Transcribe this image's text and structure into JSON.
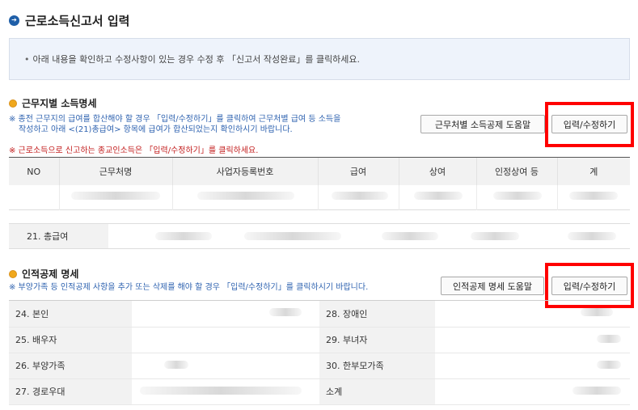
{
  "page": {
    "title": "근로소득신고서 입력"
  },
  "notice": {
    "bullet": "•",
    "text": "아래 내용을 확인하고 수정사항이 있는 경우 수정 후 「신고서 작성완료」를 클릭하세요."
  },
  "section1": {
    "title": "근무지별 소득명세",
    "note_line1": "※ 종전 근무지의 급여를 합산해야 할 경우 「입력/수정하기」를 클릭하여 근무처별 급여 등 소득을",
    "note_line2": "작성하고 아래 <(21)총급여> 항목에 급여가 합산되었는지 확인하시기 바랍니다.",
    "red_note": "※ 근로소득으로 신고하는 종교인소득은 「입력/수정하기」를 클릭하세요.",
    "help_button": "근무처별 소득공제 도움말",
    "edit_button": "입력/수정하기",
    "columns": [
      "NO",
      "근무처명",
      "사업자등록번호",
      "급여",
      "상여",
      "인정상여 등",
      "계"
    ],
    "total_label": "21. 총급여"
  },
  "section2": {
    "title": "인적공제 명세",
    "note": "※ 부양가족 등 인적공제 사항을 추가 또는 삭제를 해야 할 경우 「입력/수정하기」를 클릭하시기 바랍니다.",
    "help_button": "인적공제 명세 도움말",
    "edit_button": "입력/수정하기",
    "rows": [
      {
        "left": "24. 본인",
        "right": "28. 장애인"
      },
      {
        "left": "25. 배우자",
        "right": "29. 부녀자"
      },
      {
        "left": "26. 부양가족",
        "right": "30. 한부모가족"
      },
      {
        "left": "27. 경로우대",
        "right": "소계"
      }
    ]
  },
  "colors": {
    "accent": "#1f5fa8",
    "highlight": "#ff0000",
    "note_blue": "#2f63b0",
    "note_red": "#c21b1b"
  },
  "icons": {
    "title": "arrow-right-circle-icon",
    "section": "orange-bullet-icon"
  }
}
